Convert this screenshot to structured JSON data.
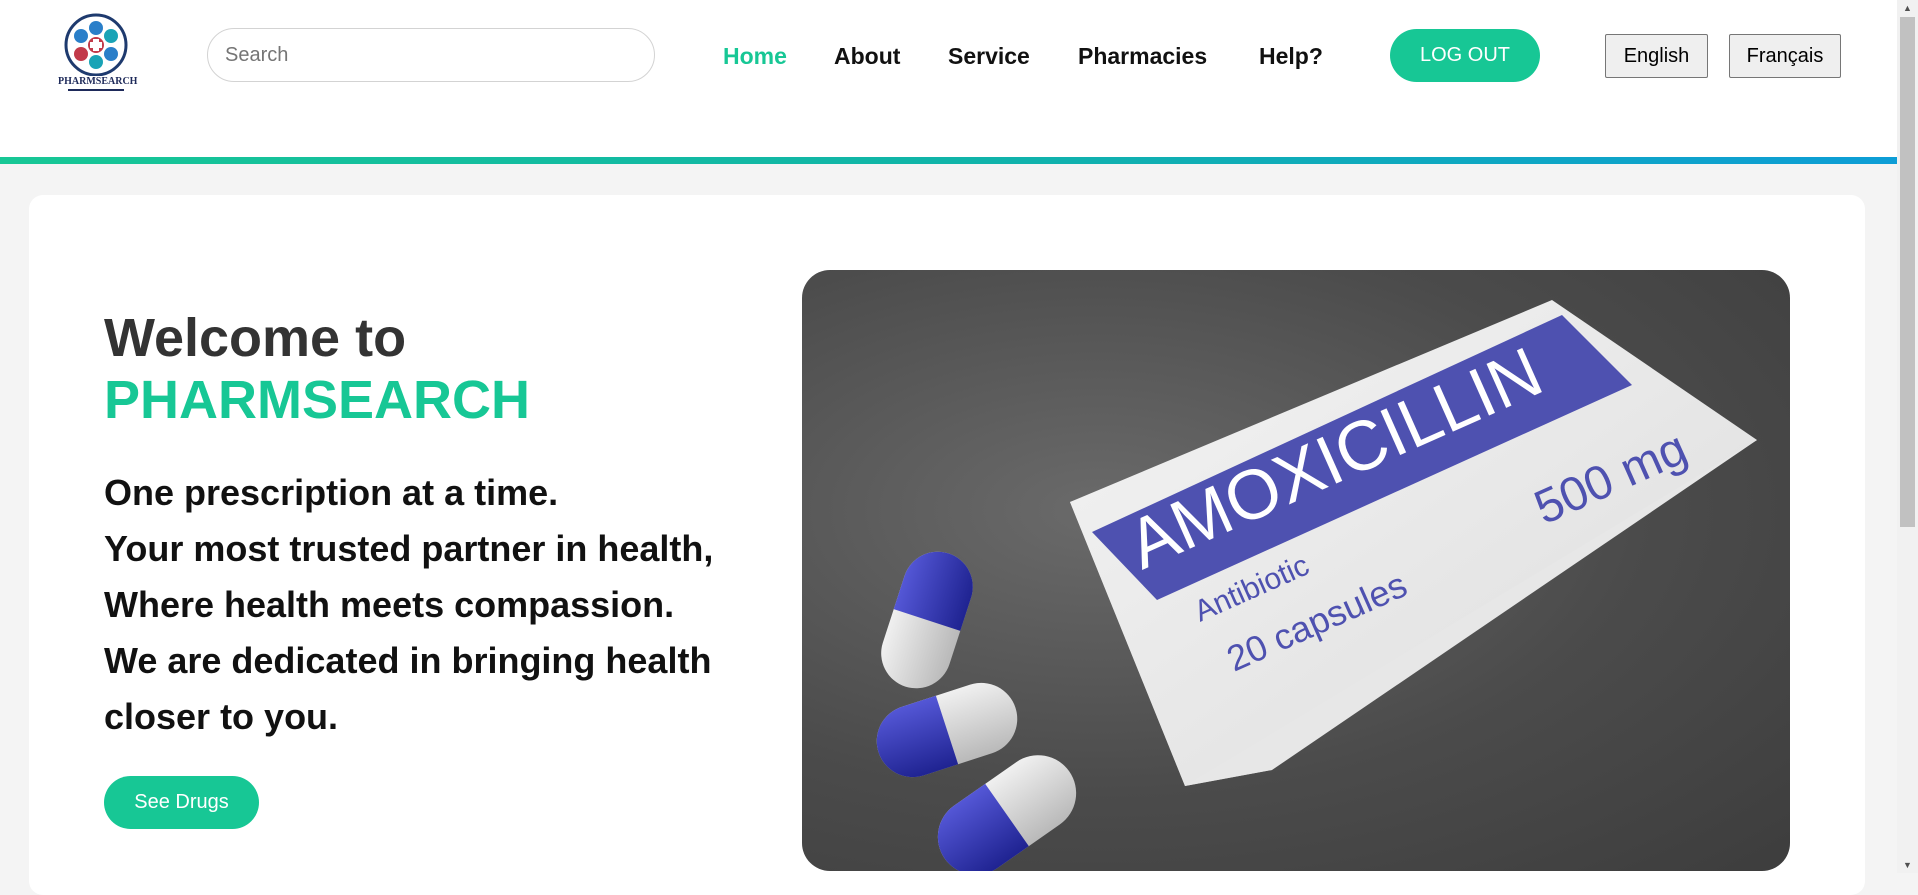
{
  "header": {
    "logo_text": "PHARMSEARCH",
    "search": {
      "placeholder": "Search",
      "value": ""
    },
    "nav": [
      {
        "label": "Home",
        "active": true
      },
      {
        "label": "About",
        "active": false
      },
      {
        "label": "Service",
        "active": false
      },
      {
        "label": "Pharmacies",
        "active": false
      },
      {
        "label": "Help?",
        "active": false
      }
    ],
    "logout_label": "LOG OUT",
    "languages": [
      "English",
      "Français"
    ]
  },
  "hero": {
    "welcome": "Welcome to",
    "brand": "PHARMSEARCH",
    "tagline": [
      "One prescription at a time.",
      "Your most trusted partner in health,",
      "Where health meets compassion.",
      "We are dedicated in bringing health",
      "closer to you."
    ],
    "cta_label": "See Drugs",
    "image": {
      "box_name": "AMOXICILLIN",
      "box_type": "Antibiotic",
      "box_count": "20 capsules",
      "box_dose": "500 mg"
    }
  },
  "colors": {
    "accent": "#17c795",
    "accent_blue": "#0d9dd6",
    "capsule_blue": "#2b2fa8",
    "box_label": "#4e51b0"
  },
  "icons": [
    "pharmsearch-logo",
    "scroll-up-arrow-icon",
    "scroll-down-arrow-icon"
  ]
}
